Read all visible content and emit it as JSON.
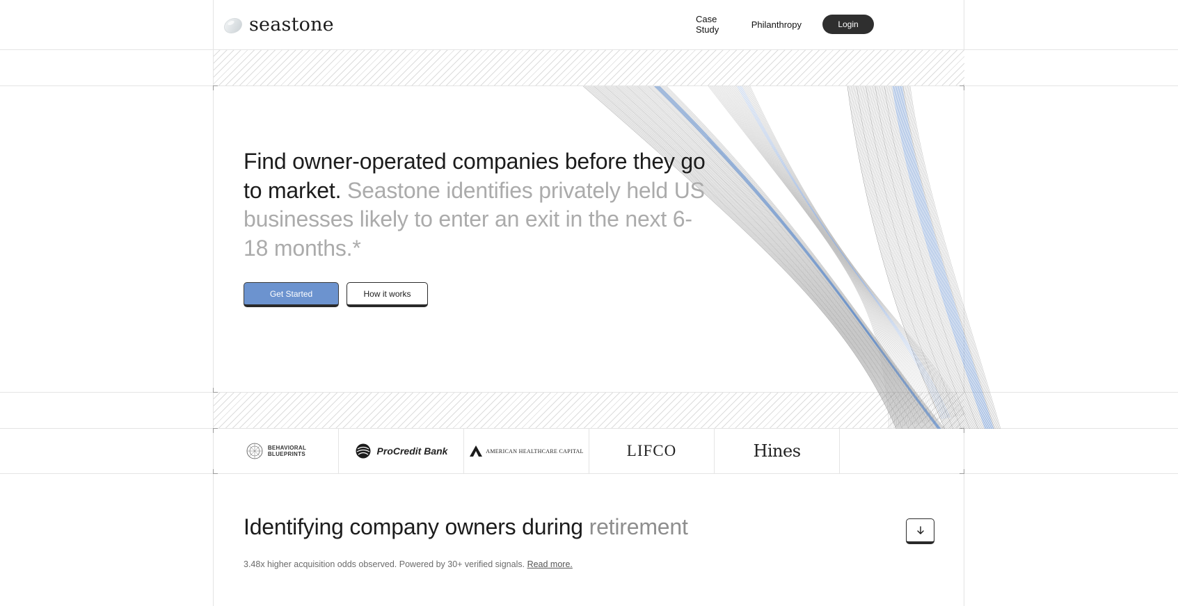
{
  "header": {
    "brand": "seastone",
    "nav": [
      {
        "label": "Case Study"
      },
      {
        "label": "Philanthropy"
      }
    ],
    "login_label": "Login"
  },
  "hero": {
    "headline_dark": "Find owner-operated companies before they go to market.",
    "headline_light": "Seastone identifies privately held US businesses likely to enter an exit in the next 6-18 months.*",
    "primary_cta": "Get Started",
    "secondary_cta": "How it works"
  },
  "logos": {
    "behavioral_blueprints": {
      "line1": "BEHAVIORAL",
      "line2": "BLUEPRINTS"
    },
    "procredit": "ProCredit Bank",
    "ahc": "American HealthCare Capital",
    "lifco": "LIFCO",
    "hines": "Hines"
  },
  "section": {
    "title_dark": "Identifying company owners during",
    "title_light": "retirement",
    "subtitle": "3.48x higher acquisition odds observed. Powered by 30+ verified signals.",
    "read_more": "Read more."
  },
  "colors": {
    "accent_blue": "#6c93cf",
    "dark": "#2f2f2f",
    "muted_text": "#ababab"
  },
  "icons": [
    "seastone-logo-icon",
    "arrow-down-icon",
    "procredit-globe-icon",
    "behavioral-blueprints-icon",
    "ahc-emblem-icon"
  ]
}
